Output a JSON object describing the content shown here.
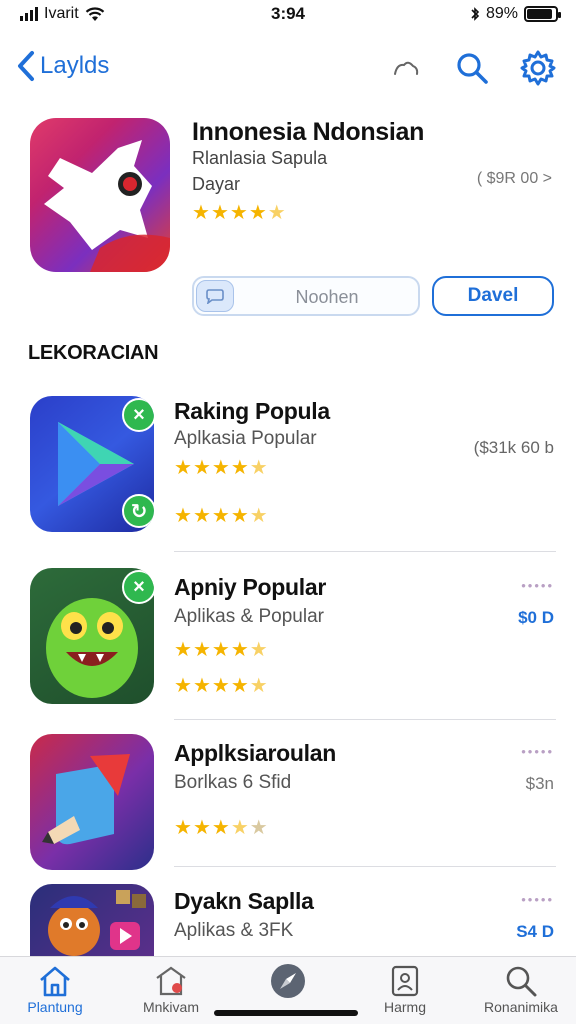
{
  "status": {
    "carrier": "Ivarit",
    "time": "3:94",
    "battery": "89%",
    "battery_level": 0.89
  },
  "nav": {
    "back_label": "Laylds"
  },
  "hero": {
    "title": "Innonesia Ndonsian",
    "subtitle": "Rlanlasia Sapula",
    "developer": "Dayar",
    "price": "( $9R 00 >",
    "rating": 4.5,
    "search_placeholder": "Noohen",
    "button_label": "Davel"
  },
  "section_title": "LEKORACIAN",
  "apps": [
    {
      "title": "Raking Popula",
      "subtitle": "Aplkasia Popular",
      "price": "($31k 60 b",
      "rating1": 4.5,
      "rating2": 4.5,
      "icon": "play-icon"
    },
    {
      "title": "Apniy Popular",
      "subtitle": "Aplikas & Popular",
      "price": "$0 D",
      "more": "•••••",
      "rating1": 4.5,
      "rating2": 4.5,
      "icon": "monster-icon"
    },
    {
      "title": "Applksiaroulan",
      "subtitle": "Borlkas 6 Sfid",
      "price": "$3n",
      "more": "•••••",
      "rating1": 3.5,
      "icon": "draw-icon"
    },
    {
      "title": "Dyakn Saplla",
      "subtitle": "Aplikas & 3FK",
      "price": "S4 D",
      "more": "•••••",
      "icon": "game-icon"
    }
  ],
  "tabs": [
    {
      "label": "Plantung",
      "icon": "house-icon",
      "active": true
    },
    {
      "label": "Mnkivam",
      "icon": "store-icon",
      "active": false
    },
    {
      "label": "",
      "icon": "compass-icon",
      "active": false
    },
    {
      "label": "Harmg",
      "icon": "profile-icon",
      "active": false
    },
    {
      "label": "Ronanimika",
      "icon": "search-icon",
      "active": false
    }
  ],
  "colors": {
    "accent": "#1f6fd8",
    "star": "#f5b400"
  }
}
